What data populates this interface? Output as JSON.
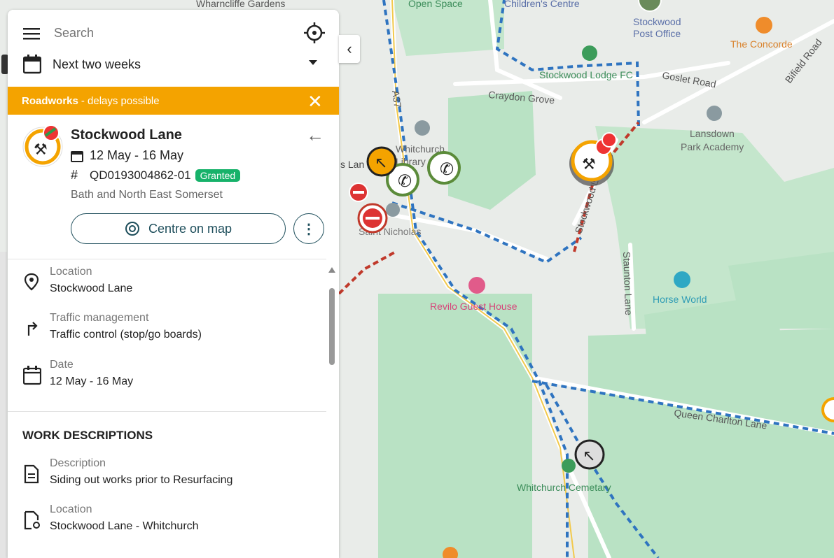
{
  "search": {
    "placeholder": "Search"
  },
  "timeframe": {
    "selected": "Next two weeks"
  },
  "banner": {
    "bold": "Roadworks",
    "text": " - delays possible"
  },
  "work": {
    "title": "Stockwood Lane",
    "dates": "12 May - 16 May",
    "reference": "QD0193004862-01",
    "status": "Granted",
    "authority": "Bath and North East Somerset",
    "centre_label": "Centre on map"
  },
  "details": [
    {
      "label": "Location",
      "value": "Stockwood Lane",
      "icon": "map-pin-icon"
    },
    {
      "label": "Traffic management",
      "value": "Traffic control (stop/go boards)",
      "icon": "turn-arrow-icon"
    },
    {
      "label": "Date",
      "value": "12 May - 16 May",
      "icon": "calendar-icon"
    }
  ],
  "work_descriptions": {
    "heading": "WORK DESCRIPTIONS",
    "items": [
      {
        "label": "Description",
        "value": "Siding out works prior to Resurfacing",
        "icon": "document-icon"
      },
      {
        "label": "Location",
        "value": "Stockwood Lane - Whitchurch",
        "icon": "document-pin-icon"
      }
    ]
  },
  "map_labels": {
    "wharncliffe": "Wharncliffe Gardens",
    "open_space": "Open Space",
    "childrens_centre": "Children's Centre",
    "post_office": "Stockwood\nPost Office",
    "concorde": "The Concorde",
    "bifield": "Bifield Road",
    "goslet": "Goslet Road",
    "lodge": "Stockwood Lodge FC",
    "craydon": "Craydon Grove",
    "lansdown": "Lansdown\nPark Academy",
    "whitchurch_library": "Whitchurch\nLibrary",
    "a37": "A37",
    "stockwood_lane": "Stockwood Lane",
    "saint_nicholas": "Saint Nicholas",
    "staunton": "Staunton Lane",
    "horse_world": "Horse World",
    "revilo": "Revilo Guest House",
    "queen_charlton": "Queen Charlton Lane",
    "cemetary": "Whitchurch Cemetary",
    "s_lan": "s Lan"
  },
  "colors": {
    "accent": "#f4a300",
    "teal": "#1f4f5c",
    "granted": "#17b26a",
    "park": "#b9e2c4"
  }
}
